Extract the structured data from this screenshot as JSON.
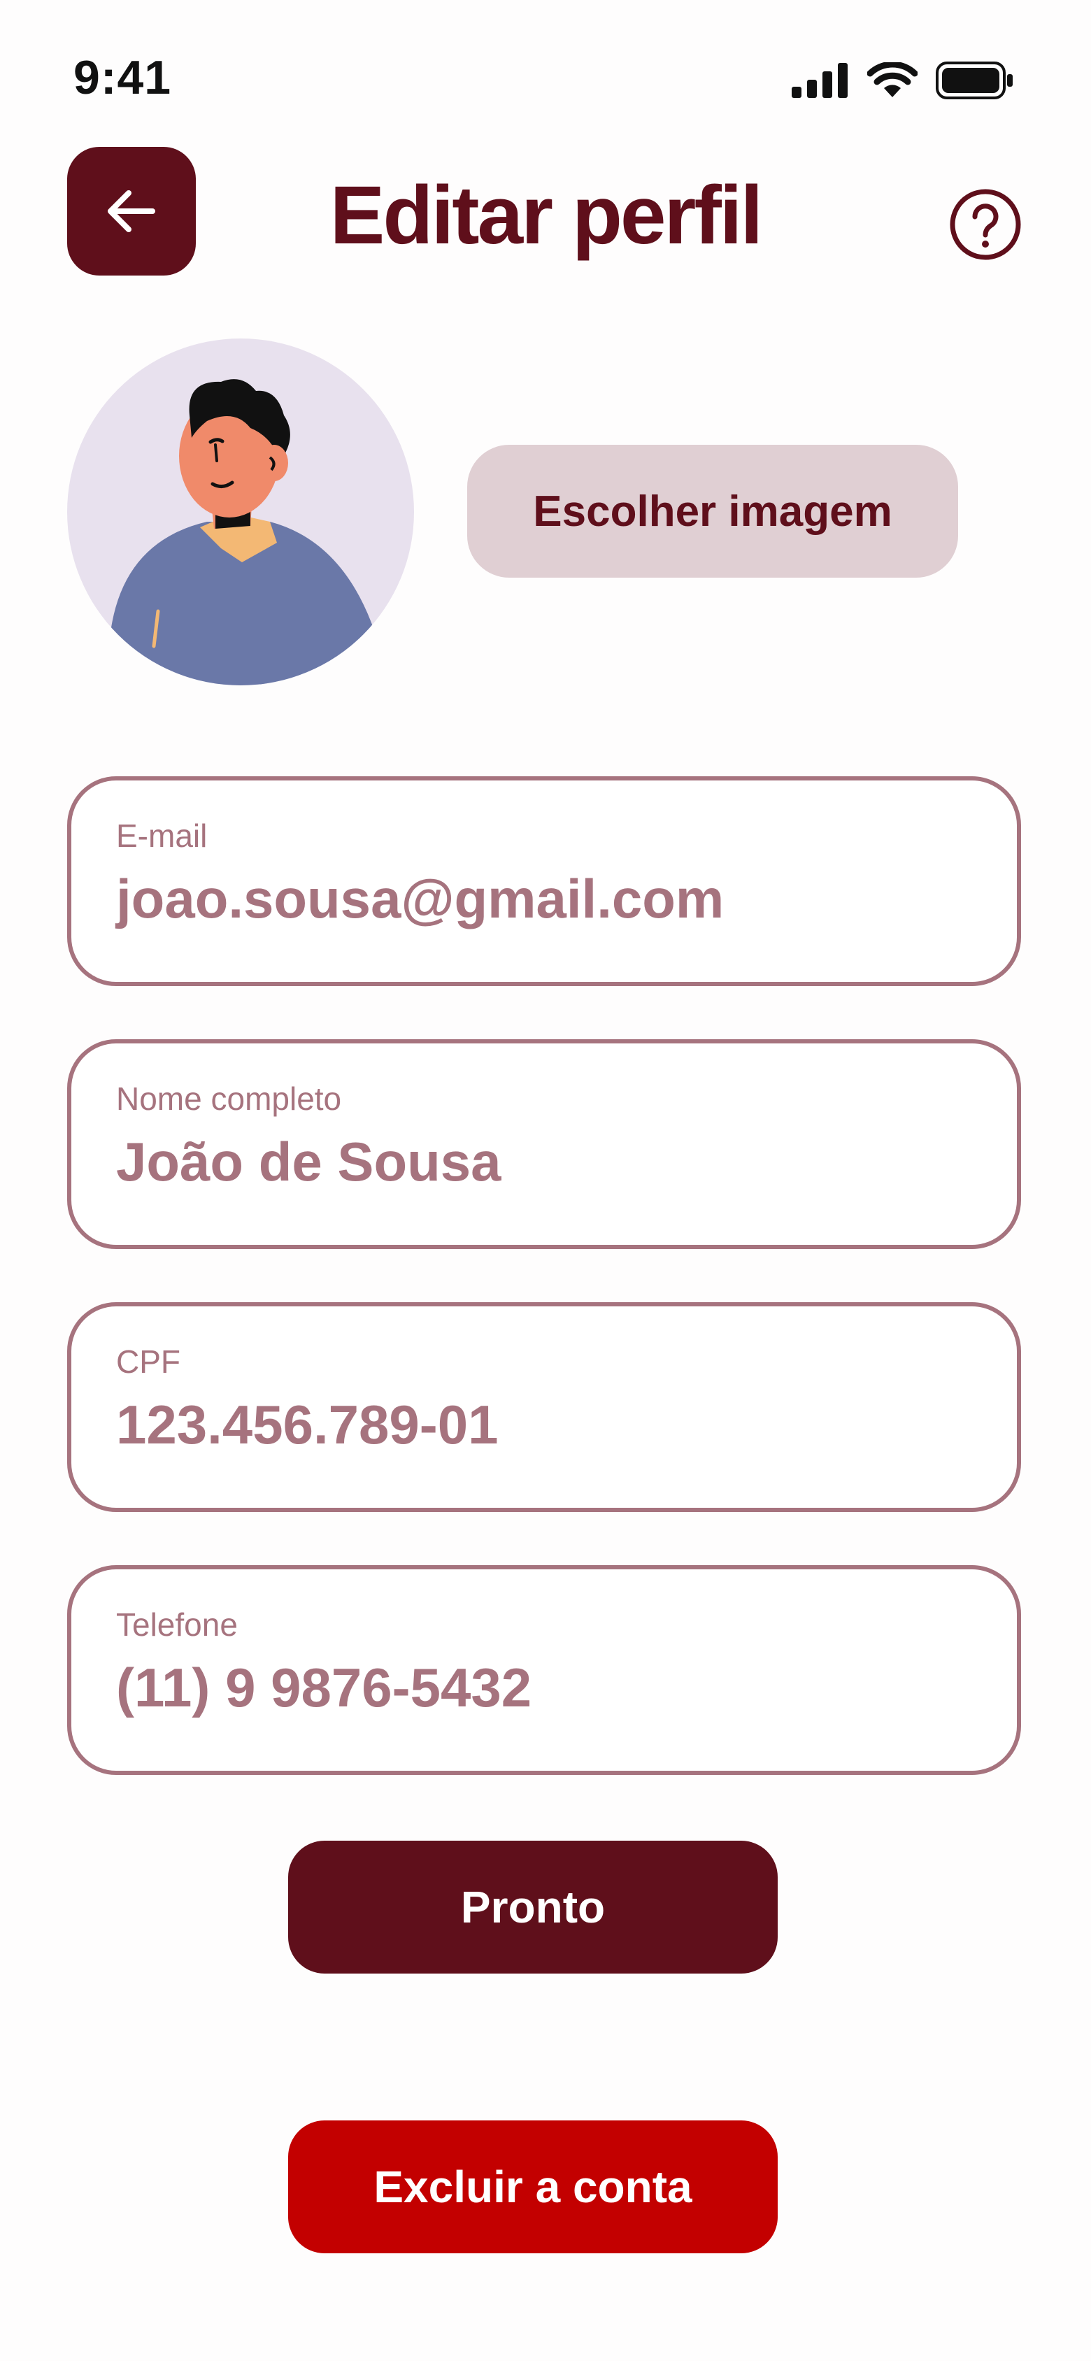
{
  "status_bar": {
    "time": "9:41",
    "icons": [
      "signal-icon",
      "wifi-icon",
      "battery-icon"
    ]
  },
  "header": {
    "back_icon": "arrow-left-icon",
    "title": "Editar perfil",
    "help_icon": "question-circle-icon"
  },
  "profile": {
    "avatar": "avatar-illustration",
    "choose_image_label": "Escolher imagem"
  },
  "form": {
    "fields": [
      {
        "label": "E-mail",
        "value": "joao.sousa@gmail.com"
      },
      {
        "label": "Nome completo",
        "value": "João de Sousa"
      },
      {
        "label": "CPF",
        "value": "123.456.789-01"
      },
      {
        "label": "Telefone",
        "value": "(11) 9 9876-5432"
      }
    ]
  },
  "actions": {
    "done_label": "Pronto",
    "delete_label": "Excluir a conta"
  },
  "colors": {
    "primary": "#5f0f1b",
    "field_border": "#a6737e",
    "secondary_button": "#e0cfd3",
    "danger": "#c30000",
    "avatar_bg": "#e8e1ee"
  }
}
